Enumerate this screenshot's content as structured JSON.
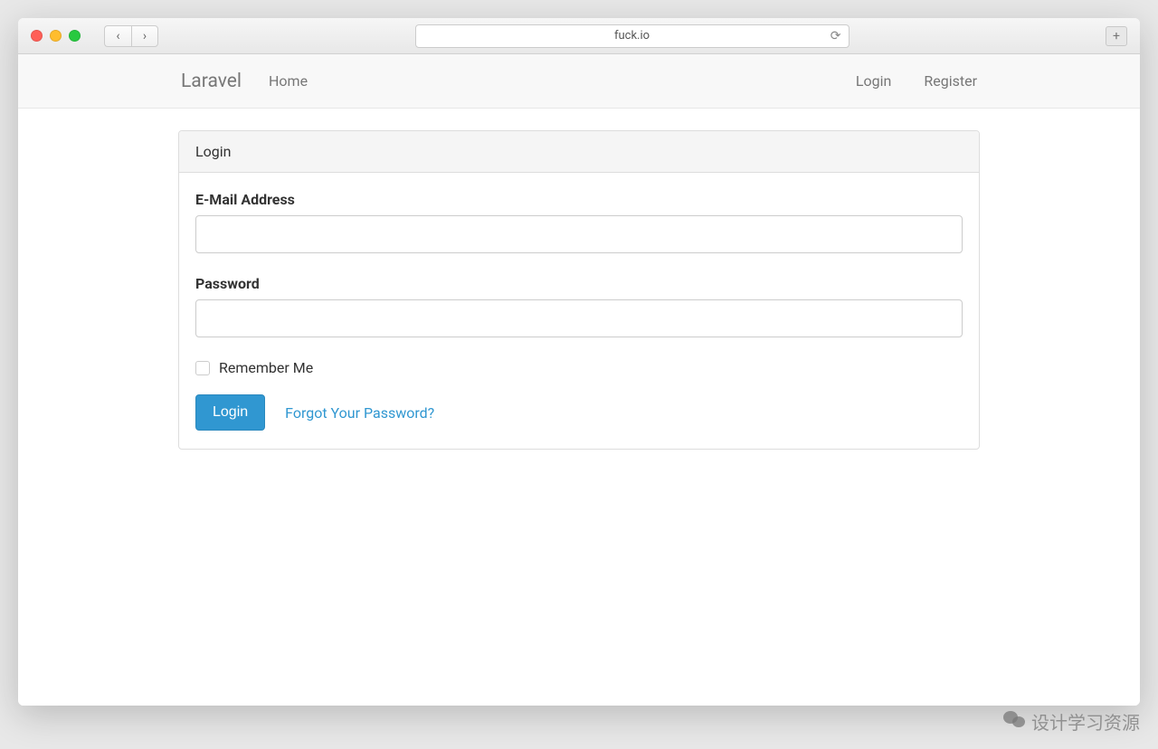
{
  "browser": {
    "url": "fuck.io"
  },
  "navbar": {
    "brand": "Laravel",
    "home": "Home",
    "login": "Login",
    "register": "Register"
  },
  "panel": {
    "title": "Login"
  },
  "form": {
    "email_label": "E-Mail Address",
    "email_value": "",
    "password_label": "Password",
    "password_value": "",
    "remember_label": "Remember Me",
    "submit_label": "Login",
    "forgot_label": "Forgot Your Password?"
  },
  "watermark": "设计学习资源"
}
